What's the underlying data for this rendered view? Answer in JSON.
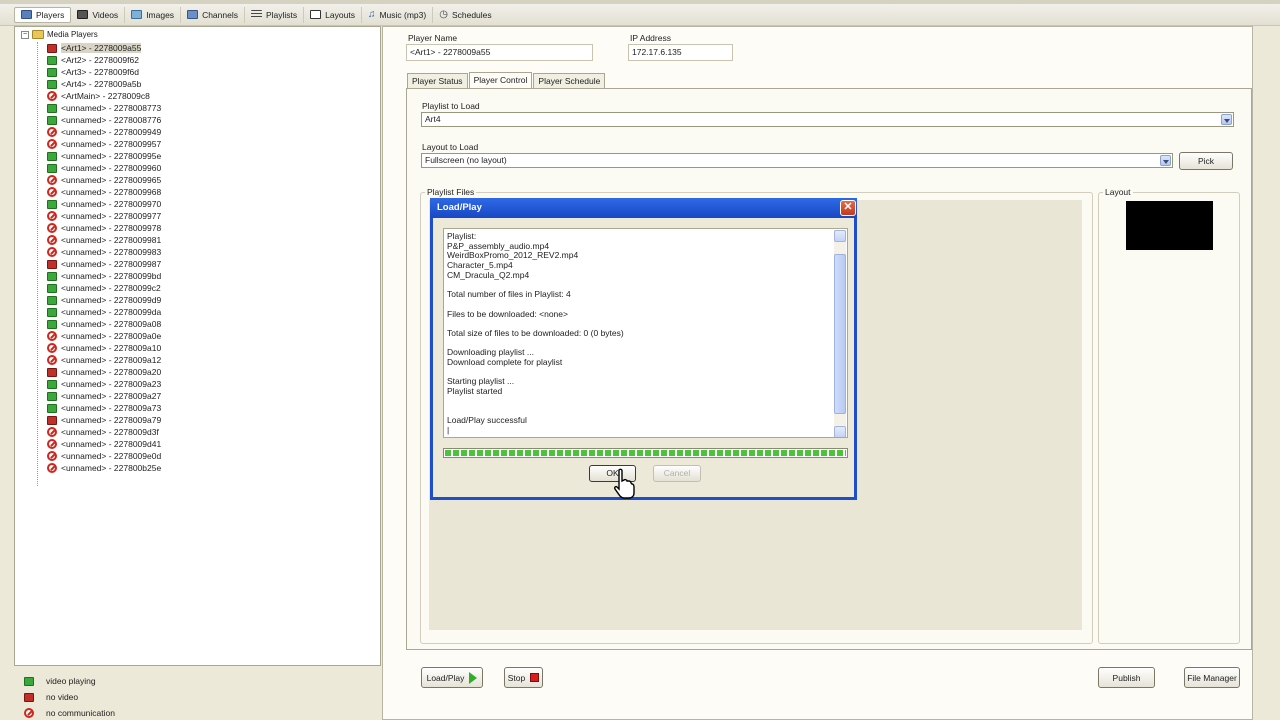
{
  "toolbar": {
    "items": [
      {
        "label": "Players",
        "icon": "players-icon",
        "active": true
      },
      {
        "label": "Videos",
        "icon": "film-icon"
      },
      {
        "label": "Images",
        "icon": "image-icon"
      },
      {
        "label": "Channels",
        "icon": "channels-icon"
      },
      {
        "label": "Playlists",
        "icon": "list-icon"
      },
      {
        "label": "Layouts",
        "icon": "layout-icon"
      },
      {
        "label": "Music (mp3)",
        "icon": "music-note-icon"
      },
      {
        "label": "Schedules",
        "icon": "clock-icon"
      }
    ]
  },
  "tree": {
    "root_label": "Media Players",
    "items": [
      {
        "label": "<Art1> - 2278009a55",
        "status": "novideo",
        "selected": true
      },
      {
        "label": "<Art2> - 2278009f62",
        "status": "playing"
      },
      {
        "label": "<Art3> - 2278009f6d",
        "status": "playing"
      },
      {
        "label": "<Art4> - 2278009a5b",
        "status": "playing"
      },
      {
        "label": "<ArtMain> - 2278009c8",
        "status": "nocomm"
      },
      {
        "label": "<unnamed> - 2278008773",
        "status": "playing"
      },
      {
        "label": "<unnamed> - 2278008776",
        "status": "playing"
      },
      {
        "label": "<unnamed> - 2278009949",
        "status": "nocomm"
      },
      {
        "label": "<unnamed> - 2278009957",
        "status": "nocomm"
      },
      {
        "label": "<unnamed> - 227800995e",
        "status": "playing"
      },
      {
        "label": "<unnamed> - 2278009960",
        "status": "playing"
      },
      {
        "label": "<unnamed> - 2278009965",
        "status": "nocomm"
      },
      {
        "label": "<unnamed> - 2278009968",
        "status": "nocomm"
      },
      {
        "label": "<unnamed> - 2278009970",
        "status": "playing"
      },
      {
        "label": "<unnamed> - 2278009977",
        "status": "nocomm"
      },
      {
        "label": "<unnamed> - 2278009978",
        "status": "nocomm"
      },
      {
        "label": "<unnamed> - 2278009981",
        "status": "nocomm"
      },
      {
        "label": "<unnamed> - 2278009983",
        "status": "nocomm"
      },
      {
        "label": "<unnamed> - 2278009987",
        "status": "novideo"
      },
      {
        "label": "<unnamed> - 22780099bd",
        "status": "playing"
      },
      {
        "label": "<unnamed> - 22780099c2",
        "status": "playing"
      },
      {
        "label": "<unnamed> - 22780099d9",
        "status": "playing"
      },
      {
        "label": "<unnamed> - 22780099da",
        "status": "playing"
      },
      {
        "label": "<unnamed> - 2278009a08",
        "status": "playing"
      },
      {
        "label": "<unnamed> - 2278009a0e",
        "status": "nocomm"
      },
      {
        "label": "<unnamed> - 2278009a10",
        "status": "nocomm"
      },
      {
        "label": "<unnamed> - 2278009a12",
        "status": "nocomm"
      },
      {
        "label": "<unnamed> - 2278009a20",
        "status": "novideo"
      },
      {
        "label": "<unnamed> - 2278009a23",
        "status": "playing"
      },
      {
        "label": "<unnamed> - 2278009a27",
        "status": "playing"
      },
      {
        "label": "<unnamed> - 2278009a73",
        "status": "playing"
      },
      {
        "label": "<unnamed> - 2278009a79",
        "status": "novideo"
      },
      {
        "label": "<unnamed> - 2278009d3f",
        "status": "nocomm"
      },
      {
        "label": "<unnamed> - 2278009d41",
        "status": "nocomm"
      },
      {
        "label": "<unnamed> - 2278009e0d",
        "status": "nocomm"
      },
      {
        "label": "<unnamed> - 227800b25e",
        "status": "nocomm"
      }
    ]
  },
  "legend": {
    "playing": "video playing",
    "novideo": "no video",
    "nocomm": "no communication"
  },
  "player": {
    "name_label": "Player Name",
    "name_value": "<Art1> - 2278009a55",
    "ip_label": "IP Address",
    "ip_value": "172.17.6.135"
  },
  "tabs": [
    "Player Status",
    "Player Control",
    "Player Schedule"
  ],
  "control": {
    "playlist_label": "Playlist to Load",
    "playlist_value": "Art4",
    "layout_label": "Layout to Load",
    "layout_value": "Fullscreen (no layout)",
    "pick_label": "Pick",
    "playlist_files_label": "Playlist Files",
    "layout_group_label": "Layout",
    "load_play_label": "Load/Play",
    "stop_label": "Stop",
    "publish_label": "Publish",
    "file_manager_label": "File Manager"
  },
  "dialog": {
    "title": "Load/Play",
    "close": "✕",
    "lines": [
      "Playlist:",
      "P&P_assembly_audio.mp4",
      "WeirdBoxPromo_2012_REV2.mp4",
      "Character_5.mp4",
      "CM_Dracula_Q2.mp4",
      "",
      "Total number of files in Playlist: 4",
      "",
      "Files to be downloaded: <none>",
      "",
      "Total size of files to be downloaded: 0 (0 bytes)",
      "",
      "Downloading playlist ...",
      "Download complete for playlist",
      "",
      "Starting playlist ...",
      "Playlist started",
      "",
      "",
      "Load/Play successful",
      "|"
    ],
    "progress": 1.0,
    "ok_label": "OK",
    "cancel_label": "Cancel"
  },
  "colors": {
    "playing": "#3aa83a",
    "novideo": "#c0302a",
    "nocomm": "#d0261e",
    "dialog_title": "#1f4ec9",
    "progress": "#4cc43a"
  }
}
